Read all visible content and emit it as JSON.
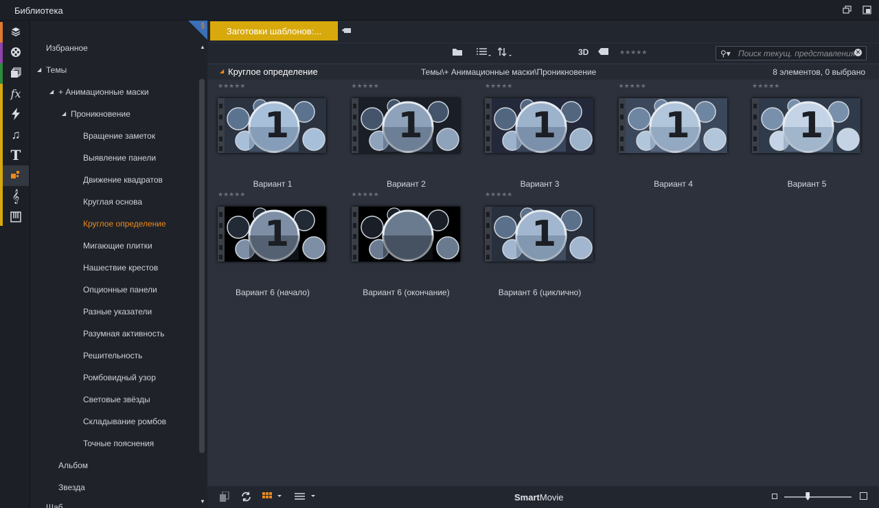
{
  "window": {
    "title": "Библиотека"
  },
  "rail": {
    "items": [
      {
        "icon": "project-bins-icon",
        "color": "#e07a2c"
      },
      {
        "icon": "film-reel-icon",
        "color": "#8e44ad"
      },
      {
        "icon": "collections-icon",
        "color": "#2e8b3d"
      },
      {
        "icon": "effects-fx-icon",
        "color": "#d7a90c"
      },
      {
        "icon": "transitions-bolt-icon",
        "color": "#d7a90c"
      },
      {
        "icon": "music-note-icon",
        "color": "#d7a90c"
      },
      {
        "icon": "titles-text-icon",
        "color": "#d7a90c"
      },
      {
        "icon": "montage-templates-icon",
        "color": "#d7a90c"
      },
      {
        "icon": "sound-effects-icon",
        "color": "#d7a90c"
      },
      {
        "icon": "keyboard-icon",
        "color": "#d7a90c"
      }
    ]
  },
  "tree": {
    "favorites": "Избранное",
    "themes": "Темы",
    "anim_masks": "+ Анимационные маски",
    "penetration": "Проникновение",
    "items": [
      "Вращение заметок",
      "Выявление панели",
      "Движение квадратов",
      "Круглая основа",
      "Круглое определение",
      "Мигающие плитки",
      "Нашествие крестов",
      "Опционные панели",
      "Разные указатели",
      "Разумная активность",
      "Решительность",
      "Ромбовидный узор",
      "Световые звёзды",
      "Складывание ромбов",
      "Точные пояснения"
    ],
    "selected_index": 4,
    "album": "Альбом",
    "star": "Звезда",
    "partial": "Шаб..."
  },
  "tab": {
    "label": "Заготовки шаблонов:..."
  },
  "toolbar": {
    "three_d": "3D",
    "rating_stars": "★★★★★",
    "search_placeholder": "Поиск текущ. представления"
  },
  "header": {
    "title": "Круглое определение",
    "path": "Темы\\+ Анимационные маски\\Проникновение",
    "count": "8 элементов, 0 выбрано"
  },
  "thumbnails": [
    {
      "caption": "Вариант 1",
      "digit": "1"
    },
    {
      "caption": "Вариант 2",
      "digit": "1"
    },
    {
      "caption": "Вариант 3",
      "digit": "1"
    },
    {
      "caption": "Вариант 4",
      "digit": "1"
    },
    {
      "caption": "Вариант 5",
      "digit": "1"
    },
    {
      "caption": "Вариант 6 (начало)",
      "digit": "1"
    },
    {
      "caption": "Вариант 6 (окончание)",
      "digit": ""
    },
    {
      "caption": "Вариант 6 (циклично)",
      "digit": "1"
    }
  ],
  "thumb_rating": "★★★★★",
  "bottom": {
    "brand_bold": "Smart",
    "brand_rest": "Movie",
    "zoom_level": 0.35
  },
  "colors": {
    "accent": "#ec8a1b",
    "tab": "#d7a90c"
  }
}
